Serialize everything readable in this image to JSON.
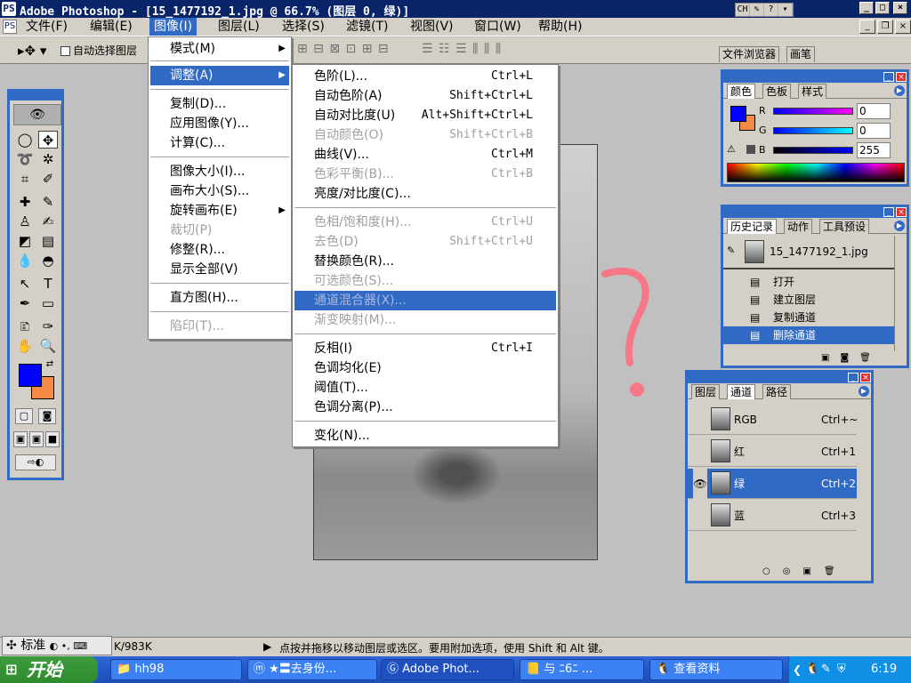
{
  "window": {
    "title": "Adobe Photoshop - [15_1477192_1.jpg @ 66.7% (图层 0, 绿)]"
  },
  "ime_icons": [
    "CH",
    "ime-pad-icon",
    "help-icon",
    "menu-arrow-icon"
  ],
  "menubar": {
    "items": [
      "文件(F)",
      "编辑(E)",
      "图像(I)",
      "图层(L)",
      "选择(S)",
      "滤镜(T)",
      "视图(V)",
      "窗口(W)",
      "帮助(H)"
    ],
    "active": "图像(I)"
  },
  "options": {
    "auto_select_label": "自动选择图层",
    "tabs": [
      "文件浏览器",
      "画笔"
    ]
  },
  "image_menu": [
    {
      "label": "模式(M)",
      "submenu": true
    },
    {
      "label": "调整(A)",
      "submenu": true,
      "highlighted": true
    },
    {
      "label": "复制(D)..."
    },
    {
      "label": "应用图像(Y)..."
    },
    {
      "label": "计算(C)..."
    },
    {
      "label": "图像大小(I)..."
    },
    {
      "label": "画布大小(S)..."
    },
    {
      "label": "旋转画布(E)",
      "submenu": true
    },
    {
      "label": "裁切(P)",
      "disabled": true
    },
    {
      "label": "修整(R)..."
    },
    {
      "label": "显示全部(V)"
    },
    {
      "label": "直方图(H)..."
    },
    {
      "label": "陷印(T)...",
      "disabled": true
    }
  ],
  "adjust_menu": [
    {
      "label": "色阶(L)...",
      "shortcut": "Ctrl+L"
    },
    {
      "label": "自动色阶(A)",
      "shortcut": "Shift+Ctrl+L"
    },
    {
      "label": "自动对比度(U)",
      "shortcut": "Alt+Shift+Ctrl+L"
    },
    {
      "label": "自动颜色(O)",
      "shortcut": "Shift+Ctrl+B",
      "disabled": true
    },
    {
      "label": "曲线(V)...",
      "shortcut": "Ctrl+M"
    },
    {
      "label": "色彩平衡(B)...",
      "shortcut": "Ctrl+B",
      "disabled": true
    },
    {
      "label": "亮度/对比度(C)..."
    },
    {
      "label": "色相/饱和度(H)...",
      "shortcut": "Ctrl+U",
      "disabled": true
    },
    {
      "label": "去色(D)",
      "shortcut": "Shift+Ctrl+U",
      "disabled": true
    },
    {
      "label": "替换颜色(R)..."
    },
    {
      "label": "可选颜色(S)...",
      "disabled": true
    },
    {
      "label": "通道混合器(X)...",
      "disabled": true,
      "highlighted": true
    },
    {
      "label": "渐变映射(M)...",
      "disabled": true
    },
    {
      "label": "反相(I)",
      "shortcut": "Ctrl+I"
    },
    {
      "label": "色调均化(E)"
    },
    {
      "label": "阈值(T)..."
    },
    {
      "label": "色调分离(P)..."
    },
    {
      "label": "变化(N)..."
    }
  ],
  "color_panel": {
    "tabs": [
      "颜色",
      "色板",
      "样式"
    ],
    "channels": [
      {
        "label": "R",
        "value": "0"
      },
      {
        "label": "G",
        "value": "0"
      },
      {
        "label": "B",
        "value": "255"
      }
    ],
    "foreground": "#0000ff",
    "background": "#f58a45"
  },
  "history_panel": {
    "tabs": [
      "历史记录",
      "动作",
      "工具预设"
    ],
    "snapshot": "15_1477192_1.jpg",
    "states": [
      "打开",
      "建立图层",
      "复制通道",
      "删除通道"
    ],
    "selected": "删除通道"
  },
  "channels_panel": {
    "tabs": [
      "图层",
      "通道",
      "路径"
    ],
    "channels": [
      {
        "name": "RGB",
        "shortcut": "Ctrl+~"
      },
      {
        "name": "红",
        "shortcut": "Ctrl+1"
      },
      {
        "name": "绿",
        "shortcut": "Ctrl+2",
        "selected": true,
        "visible": true
      },
      {
        "name": "蓝",
        "shortcut": "Ctrl+3"
      }
    ]
  },
  "statusbar": {
    "doc_size": "K/983K",
    "hint": "点按并拖移以移动图层或选区。要用附加选项，使用 Shift 和 Alt 键。",
    "ime": "标准"
  },
  "taskbar": {
    "start": "开始",
    "tasks": [
      "hh98",
      "★〓去身份...",
      "Adobe Phot...",
      "与 ﾆ6ﾆ  ...",
      "查看资料"
    ],
    "active": "Adobe Phot...",
    "clock": "6:19"
  },
  "annotation_color": "#ff6b7d"
}
